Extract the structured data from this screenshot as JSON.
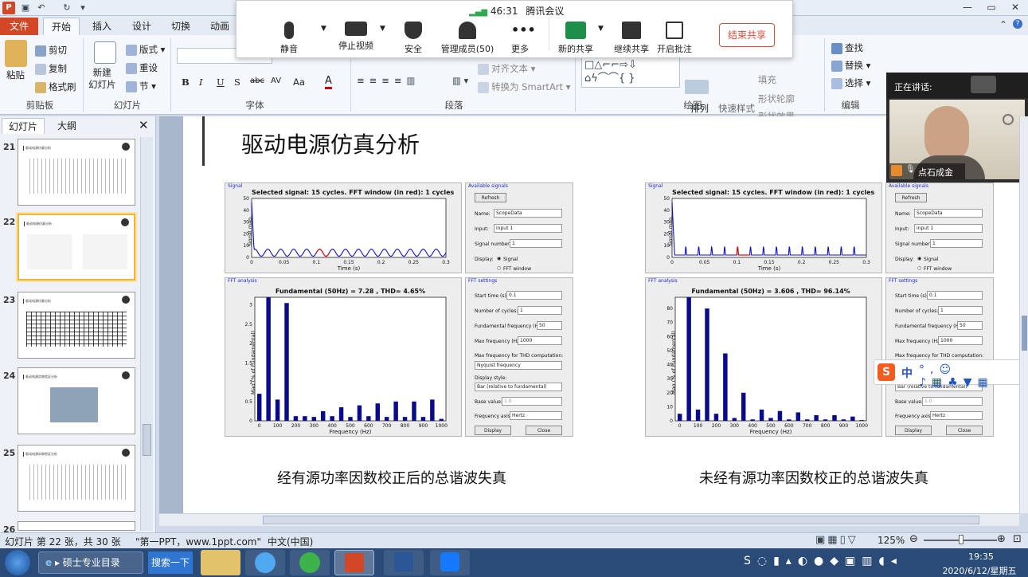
{
  "titlebar": {
    "icon": "powerpoint-icon"
  },
  "menu": {
    "file": "文件",
    "tabs": [
      "开始",
      "插入",
      "设计",
      "切换",
      "动画"
    ]
  },
  "ribbon": {
    "clipboard": {
      "paste": "粘贴",
      "cut": "剪切",
      "copy": "复制",
      "format_painter": "格式刷",
      "label": "剪贴板"
    },
    "slides": {
      "new_slide": "新建\n幻灯片",
      "layout": "版式",
      "reset": "重设",
      "section": "节",
      "label": "幻灯片"
    },
    "font": {
      "label": "字体",
      "bold": "B",
      "italic": "I",
      "underline": "U",
      "strike": "S",
      "shadow": "abc",
      "spacing": "AV",
      "case": "Aa",
      "color": "A"
    },
    "paragraph": {
      "label": "段落",
      "align_text": "对齐文本",
      "smartart": "转换为 SmartArt"
    },
    "drawing": {
      "label": "绘图",
      "arrange": "排列",
      "quick_styles": "快速样式",
      "fill": "填充",
      "outline": "形状轮廓",
      "effects": "形状效果"
    },
    "editing": {
      "label": "编辑",
      "find": "查找",
      "replace": "替换",
      "select": "选择"
    }
  },
  "meeting": {
    "signal_time": "46:31",
    "app_name": "腾讯会议",
    "buttons": [
      "静音",
      "停止视频",
      "安全",
      "管理成员(50)",
      "更多",
      "新的共享",
      "继续共享",
      "开启批注"
    ],
    "end_share": "结束共享"
  },
  "video": {
    "speaking_label": "正在讲话:",
    "speaker_name": "点石成金"
  },
  "left_pane": {
    "tabs": [
      "幻灯片",
      "大纲"
    ],
    "slides": [
      {
        "num": "21",
        "title": "驱动电源仿真分析"
      },
      {
        "num": "22",
        "title": "驱动电源仿真分析"
      },
      {
        "num": "23",
        "title": "驱动电源仿真分析"
      },
      {
        "num": "24",
        "title": "驱动电源实物验证分析"
      },
      {
        "num": "25",
        "title": "驱动电源实物验证分析"
      },
      {
        "num": "26",
        "title": ""
      }
    ]
  },
  "slide": {
    "title": "驱动电源仿真分析",
    "caption_left": "经有源功率因数校正后的总谐波失真",
    "caption_right": "未经有源功率因数校正的总谐波失真"
  },
  "fft_tool": {
    "signal_panel": "Signal",
    "available_signals": "Available signals",
    "refresh": "Refresh",
    "name_label": "Name:",
    "name_value": "ScopeData",
    "input_label": "Input:",
    "input_value": "input 1",
    "signal_number_label": "Signal number:",
    "signal_number_value": "1",
    "display_label": "Display:",
    "display_signal": "Signal",
    "display_fft": "FFT window",
    "fft_analysis": "FFT analysis",
    "fft_settings": "FFT settings",
    "start_time_label": "Start time (s):",
    "start_time_value": "0.1",
    "cycles_label": "Number of cycles:",
    "cycles_value": "1",
    "fund_label": "Fundamental frequency (Hz):",
    "fund_value": "50",
    "maxf_label": "Max frequency (Hz):",
    "maxf_value": "1000",
    "thd_label": "Max frequency for THD computation:",
    "thd_value": "Nyquist frequency",
    "style_label": "Display style:",
    "style_value": "Bar (relative to fundamental)",
    "base_label": "Base value:",
    "base_value": "1.0",
    "faxis_label": "Frequency axis:",
    "faxis_value": "Hertz",
    "display_btn": "Display",
    "close_btn": "Close"
  },
  "status": {
    "slide_info": "幻灯片 第 22 张，共 30 张",
    "theme": "\"第一PPT，www.1ppt.com\"",
    "lang": "中文(中国)",
    "zoom": "125%"
  },
  "taskbar": {
    "item1": "硕士专业目录",
    "item2": "搜索一下",
    "time": "19:35",
    "date": "2020/6/12/星期五"
  },
  "ime": {
    "label": "中"
  },
  "chart_data": [
    {
      "type": "line",
      "title": "Selected signal: 15 cycles. FFT window (in red): 1 cycles",
      "xlabel": "Time (s)",
      "ylabel": "Signal mag.",
      "xlim": [
        0,
        0.3
      ],
      "ylim": [
        0,
        50
      ],
      "xticks": [
        "0",
        "0.05",
        "0.1",
        "0.15",
        "0.2",
        "0.25",
        "0.3"
      ],
      "yticks": [
        "0",
        "10",
        "20",
        "30",
        "40",
        "50"
      ],
      "pattern": "sine",
      "peak": 47,
      "baseline": 4,
      "amplitude": 3,
      "cycles": 15,
      "red_window": [
        0.1,
        0.12
      ]
    },
    {
      "type": "bar",
      "title": "Fundamental (50Hz) = 7.28 , THD= 4.65%",
      "xlabel": "Frequency (Hz)",
      "ylabel": "Mag (% of Fundamental)",
      "xlim": [
        -25,
        1025
      ],
      "ylim": [
        0,
        3.2
      ],
      "xticks": [
        "0",
        "100",
        "200",
        "300",
        "400",
        "500",
        "600",
        "700",
        "800",
        "900",
        "1000"
      ],
      "yticks": [
        "0",
        "0.5",
        "1",
        "1.5",
        "2",
        "2.5",
        "3"
      ],
      "x": [
        0,
        50,
        100,
        150,
        200,
        250,
        300,
        350,
        400,
        450,
        500,
        550,
        600,
        650,
        700,
        750,
        800,
        850,
        900,
        950,
        1000
      ],
      "values": [
        0.7,
        3.2,
        0.55,
        3.05,
        0.12,
        0.12,
        0.1,
        0.25,
        0.12,
        0.35,
        0.1,
        0.4,
        0.12,
        0.45,
        0.1,
        0.5,
        0.1,
        0.5,
        0.1,
        0.55,
        0.05
      ]
    },
    {
      "type": "line",
      "title": "Selected signal: 15 cycles. FFT window (in red): 1 cycles",
      "xlabel": "Time (s)",
      "ylabel": "Signal mag.",
      "xlim": [
        0,
        0.3
      ],
      "ylim": [
        0,
        50
      ],
      "xticks": [
        "0",
        "0.05",
        "0.1",
        "0.15",
        "0.2",
        "0.25",
        "0.3"
      ],
      "yticks": [
        "0",
        "10",
        "20",
        "30",
        "40",
        "50"
      ],
      "pattern": "pulse",
      "peak": 47,
      "baseline": 2,
      "amplitude": 7,
      "cycles": 15,
      "red_window": [
        0.1,
        0.12
      ]
    },
    {
      "type": "bar",
      "title": "Fundamental (50Hz) = 3.606 , THD= 96.14%",
      "xlabel": "Frequency (Hz)",
      "ylabel": "Mag (% of Fundamental)",
      "xlim": [
        -25,
        1025
      ],
      "ylim": [
        0,
        88
      ],
      "xticks": [
        "0",
        "100",
        "200",
        "300",
        "400",
        "500",
        "600",
        "700",
        "800",
        "900",
        "1000"
      ],
      "yticks": [
        "0",
        "10",
        "20",
        "30",
        "40",
        "50",
        "60",
        "70",
        "80"
      ],
      "x": [
        0,
        50,
        100,
        150,
        200,
        250,
        300,
        350,
        400,
        450,
        500,
        550,
        600,
        650,
        700,
        750,
        800,
        850,
        900,
        950,
        1000
      ],
      "values": [
        5,
        88,
        8,
        80,
        5,
        48,
        2,
        20,
        1,
        8,
        2,
        7,
        1,
        6,
        1,
        4,
        1,
        4,
        1,
        3,
        0.5
      ]
    }
  ]
}
